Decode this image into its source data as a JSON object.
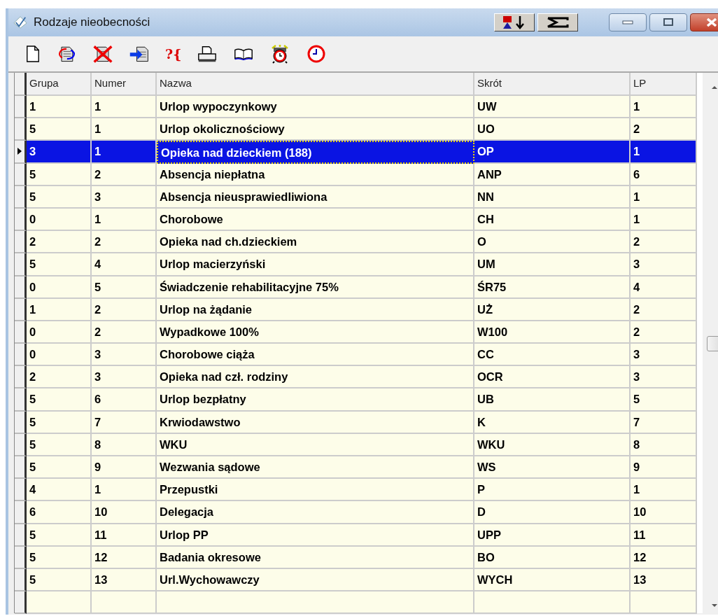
{
  "window": {
    "title": "Rodzaje nieobecności"
  },
  "toolbar": [
    {
      "kind": "new"
    },
    {
      "kind": "refresh"
    },
    {
      "kind": "delete"
    },
    {
      "kind": "import"
    },
    {
      "kind": "glyph",
      "label": "?{"
    },
    {
      "kind": "print"
    },
    {
      "kind": "book"
    },
    {
      "kind": "alarm"
    },
    {
      "kind": "clock"
    }
  ],
  "table": {
    "columns": [
      "Grupa",
      "Numer",
      "Nazwa",
      "Skrót",
      "LP"
    ],
    "rows": [
      {
        "cells": [
          "1",
          "1",
          "Urlop wypoczynkowy",
          "UW",
          "1"
        ],
        "selected": false
      },
      {
        "cells": [
          "5",
          "1",
          "Urlop okolicznościowy",
          "UO",
          "2"
        ],
        "selected": false
      },
      {
        "cells": [
          "3",
          "1",
          "Opieka nad dzieckiem (188)",
          "OP",
          "1"
        ],
        "selected": true
      },
      {
        "cells": [
          "5",
          "2",
          "Absencja niepłatna",
          "ANP",
          "6"
        ],
        "selected": false
      },
      {
        "cells": [
          "5",
          "3",
          "Absencja nieusprawiedliwiona",
          "NN",
          "1"
        ],
        "selected": false
      },
      {
        "cells": [
          "0",
          "1",
          "Chorobowe",
          "CH",
          "1"
        ],
        "selected": false
      },
      {
        "cells": [
          "2",
          "2",
          "Opieka nad ch.dzieckiem",
          "O",
          "2"
        ],
        "selected": false
      },
      {
        "cells": [
          "5",
          "4",
          "Urlop macierzyński",
          "UM",
          "3"
        ],
        "selected": false
      },
      {
        "cells": [
          "0",
          "5",
          "Świadczenie rehabilitacyjne 75%",
          "ŚR75",
          "4"
        ],
        "selected": false
      },
      {
        "cells": [
          "1",
          "2",
          "Urlop na żądanie",
          "UŻ",
          "2"
        ],
        "selected": false
      },
      {
        "cells": [
          "0",
          "2",
          "Wypadkowe 100%",
          "W100",
          "2"
        ],
        "selected": false
      },
      {
        "cells": [
          "0",
          "3",
          "Chorobowe ciąża",
          "CC",
          "3"
        ],
        "selected": false
      },
      {
        "cells": [
          "2",
          "3",
          "Opieka nad czł. rodziny",
          "OCR",
          "3"
        ],
        "selected": false
      },
      {
        "cells": [
          "5",
          "6",
          "Urlop bezpłatny",
          "UB",
          "5"
        ],
        "selected": false
      },
      {
        "cells": [
          "5",
          "7",
          "Krwiodawstwo",
          "K",
          "7"
        ],
        "selected": false
      },
      {
        "cells": [
          "5",
          "8",
          "WKU",
          "WKU",
          "8"
        ],
        "selected": false
      },
      {
        "cells": [
          "5",
          "9",
          "Wezwania sądowe",
          "WS",
          "9"
        ],
        "selected": false
      },
      {
        "cells": [
          "4",
          "1",
          "Przepustki",
          "P",
          "1"
        ],
        "selected": false
      },
      {
        "cells": [
          "6",
          "10",
          "Delegacja",
          "D",
          "10"
        ],
        "selected": false
      },
      {
        "cells": [
          "5",
          "11",
          "Urlop PP",
          "UPP",
          "11"
        ],
        "selected": false
      },
      {
        "cells": [
          "5",
          "12",
          "Badania okresowe",
          "BO",
          "12"
        ],
        "selected": false
      },
      {
        "cells": [
          "5",
          "13",
          "Url.Wychowawczy",
          "WYCH",
          "13"
        ],
        "selected": false
      }
    ]
  }
}
